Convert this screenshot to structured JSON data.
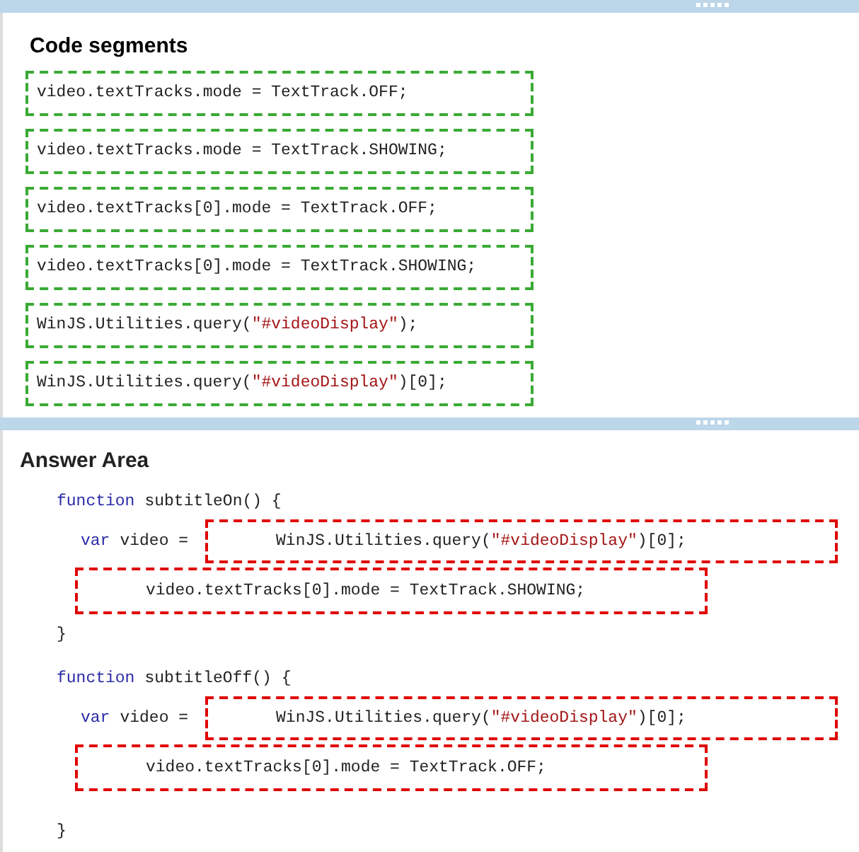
{
  "code_segments": {
    "title": "Code segments",
    "items": [
      {
        "parts": [
          {
            "kind": "code",
            "text": "video.textTracks.mode = TextTrack.OFF;"
          }
        ]
      },
      {
        "parts": [
          {
            "kind": "code",
            "text": "video.textTracks.mode = TextTrack.SHOWING;"
          }
        ]
      },
      {
        "parts": [
          {
            "kind": "code",
            "text": "video.textTracks[0].mode = TextTrack.OFF;"
          }
        ]
      },
      {
        "parts": [
          {
            "kind": "code",
            "text": "video.textTracks[0].mode = TextTrack.SHOWING;"
          }
        ]
      },
      {
        "parts": [
          {
            "kind": "code",
            "text": "WinJS.Utilities.query("
          },
          {
            "kind": "string",
            "text": "\"#videoDisplay\""
          },
          {
            "kind": "code",
            "text": ");"
          }
        ]
      },
      {
        "parts": [
          {
            "kind": "code",
            "text": "WinJS.Utilities.query("
          },
          {
            "kind": "string",
            "text": "\"#videoDisplay\""
          },
          {
            "kind": "code",
            "text": ")[0];"
          }
        ]
      }
    ]
  },
  "answer_area": {
    "title": "Answer Area",
    "functions": [
      {
        "keyword": "function",
        "signature": "subtitleOn() {",
        "var_keyword": "var",
        "var_rest": "video =",
        "slots": [
          [
            {
              "kind": "code",
              "text": "WinJS.Utilities.query("
            },
            {
              "kind": "string",
              "text": "\"#videoDisplay\""
            },
            {
              "kind": "code",
              "text": ")[0];"
            }
          ],
          [
            {
              "kind": "code",
              "text": "video.textTracks[0].mode = TextTrack.SHOWING;"
            }
          ]
        ],
        "close": "}"
      },
      {
        "keyword": "function",
        "signature": "subtitleOff() {",
        "var_keyword": "var",
        "var_rest": "video =",
        "slots": [
          [
            {
              "kind": "code",
              "text": "WinJS.Utilities.query("
            },
            {
              "kind": "string",
              "text": "\"#videoDisplay\""
            },
            {
              "kind": "code",
              "text": ")[0];"
            }
          ],
          [
            {
              "kind": "code",
              "text": "video.textTracks[0].mode = TextTrack.OFF;"
            }
          ]
        ],
        "close": "}"
      }
    ]
  }
}
